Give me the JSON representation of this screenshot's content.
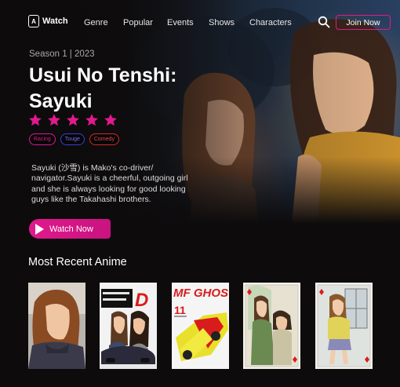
{
  "nav": {
    "logo_badge": "A",
    "logo_text": "Watch",
    "links": [
      "Genre",
      "Popular",
      "Events",
      "Shows",
      "Characters"
    ],
    "join_label": "Join Now"
  },
  "hero": {
    "season": "Season 1 | 2023",
    "title": "Usui No Tenshi: Sayuki",
    "rating": 5,
    "rating_max": 5,
    "tags": [
      "Racing",
      "Touge",
      "Comedy"
    ],
    "description": "Sayuki (沙雪) is Mako's co-driver/ navigator.Sayuki is a cheerful, outgoing girl and she is always looking for good looking guys like the Takahashi brothers.",
    "watch_label": "Watch Now"
  },
  "recent": {
    "title": "Most Recent Anime",
    "cards": [
      {
        "name": "card-sayuki-portrait"
      },
      {
        "name": "card-initial-d",
        "cover_text": "INITIAL D"
      },
      {
        "name": "card-mf-ghost",
        "cover_text": "MF GHOST",
        "cover_number": "11"
      },
      {
        "name": "card-playing-card-duo"
      },
      {
        "name": "card-playing-card-girl"
      }
    ]
  },
  "colors": {
    "accent": "#e0198c",
    "tag_racing": "#e0198c",
    "tag_touge": "#3d3ed8",
    "tag_comedy": "#d22a2a",
    "background": "#0d0b0c"
  }
}
